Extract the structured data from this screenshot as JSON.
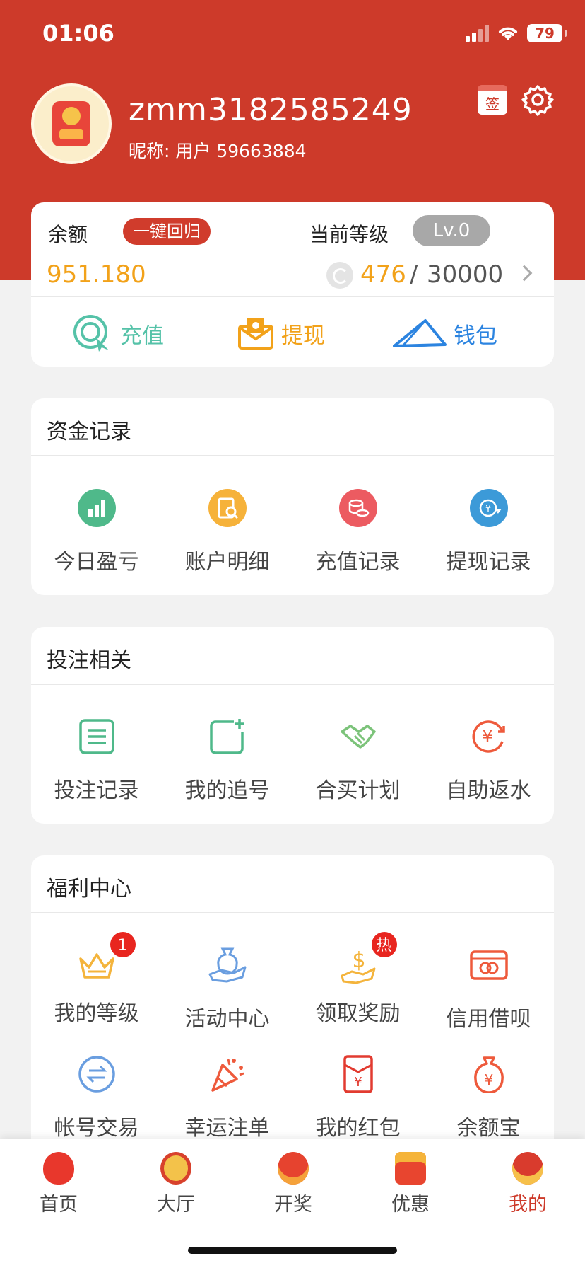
{
  "status_bar": {
    "time": "01:06",
    "battery": "79"
  },
  "profile": {
    "username": "zmm3182585249",
    "nickname": "昵称: 用户 59663884",
    "sign_label": "签"
  },
  "balance": {
    "label": "余额",
    "one_key_label": "一键回归",
    "value": "951.180",
    "level_label": "当前等级",
    "level": "Lv.0",
    "exp_current": "476",
    "exp_separator": "/",
    "exp_total": "30000"
  },
  "quick_actions": {
    "recharge": "充值",
    "withdraw": "提现",
    "wallet": "钱包"
  },
  "funds_section": {
    "title": "资金记录",
    "items": [
      {
        "label": "今日盈亏",
        "icon": "bar-chart-icon",
        "color": "#4fb98a"
      },
      {
        "label": "账户明细",
        "icon": "account-detail-icon",
        "color": "#f6b23a"
      },
      {
        "label": "充值记录",
        "icon": "coins-icon",
        "color": "#ec5b61"
      },
      {
        "label": "提现记录",
        "icon": "yuan-exchange-icon",
        "color": "#3c9ad8"
      }
    ]
  },
  "bet_section": {
    "title": "投注相关",
    "items": [
      {
        "label": "投注记录",
        "icon": "list-icon",
        "color": "#4fb98a"
      },
      {
        "label": "我的追号",
        "icon": "add-square-icon",
        "color": "#4fb98a"
      },
      {
        "label": "合买计划",
        "icon": "handshake-icon",
        "color": "#7cc37a"
      },
      {
        "label": "自助返水",
        "icon": "yuan-refresh-icon",
        "color": "#ee5a3c"
      }
    ]
  },
  "welfare_section": {
    "title": "福利中心",
    "items": [
      {
        "label": "我的等级",
        "icon": "crown-icon",
        "color": "#f4b43c",
        "badge": "1"
      },
      {
        "label": "活动中心",
        "icon": "gift-hand-icon",
        "color": "#6a9ee0"
      },
      {
        "label": "领取奖励",
        "icon": "dollar-hand-icon",
        "color": "#f4b43c",
        "badge": "热"
      },
      {
        "label": "信用借呗",
        "icon": "credit-card-icon",
        "color": "#ee5a3c"
      },
      {
        "label": "帐号交易",
        "icon": "swap-icon",
        "color": "#6a9ee0"
      },
      {
        "label": "幸运注单",
        "icon": "party-popper-icon",
        "color": "#ee5a3c"
      },
      {
        "label": "我的红包",
        "icon": "red-envelope-icon",
        "color": "#e23b30"
      },
      {
        "label": "余额宝",
        "icon": "money-bag-icon",
        "color": "#ee5a3c"
      }
    ]
  },
  "bottom_nav": [
    {
      "label": "首页",
      "icon": "lantern-icon"
    },
    {
      "label": "大厅",
      "icon": "gong-icon"
    },
    {
      "label": "开奖",
      "icon": "lottery-ball-icon"
    },
    {
      "label": "优惠",
      "icon": "gift-box-icon"
    },
    {
      "label": "我的",
      "icon": "lion-dance-icon",
      "active": true
    }
  ]
}
